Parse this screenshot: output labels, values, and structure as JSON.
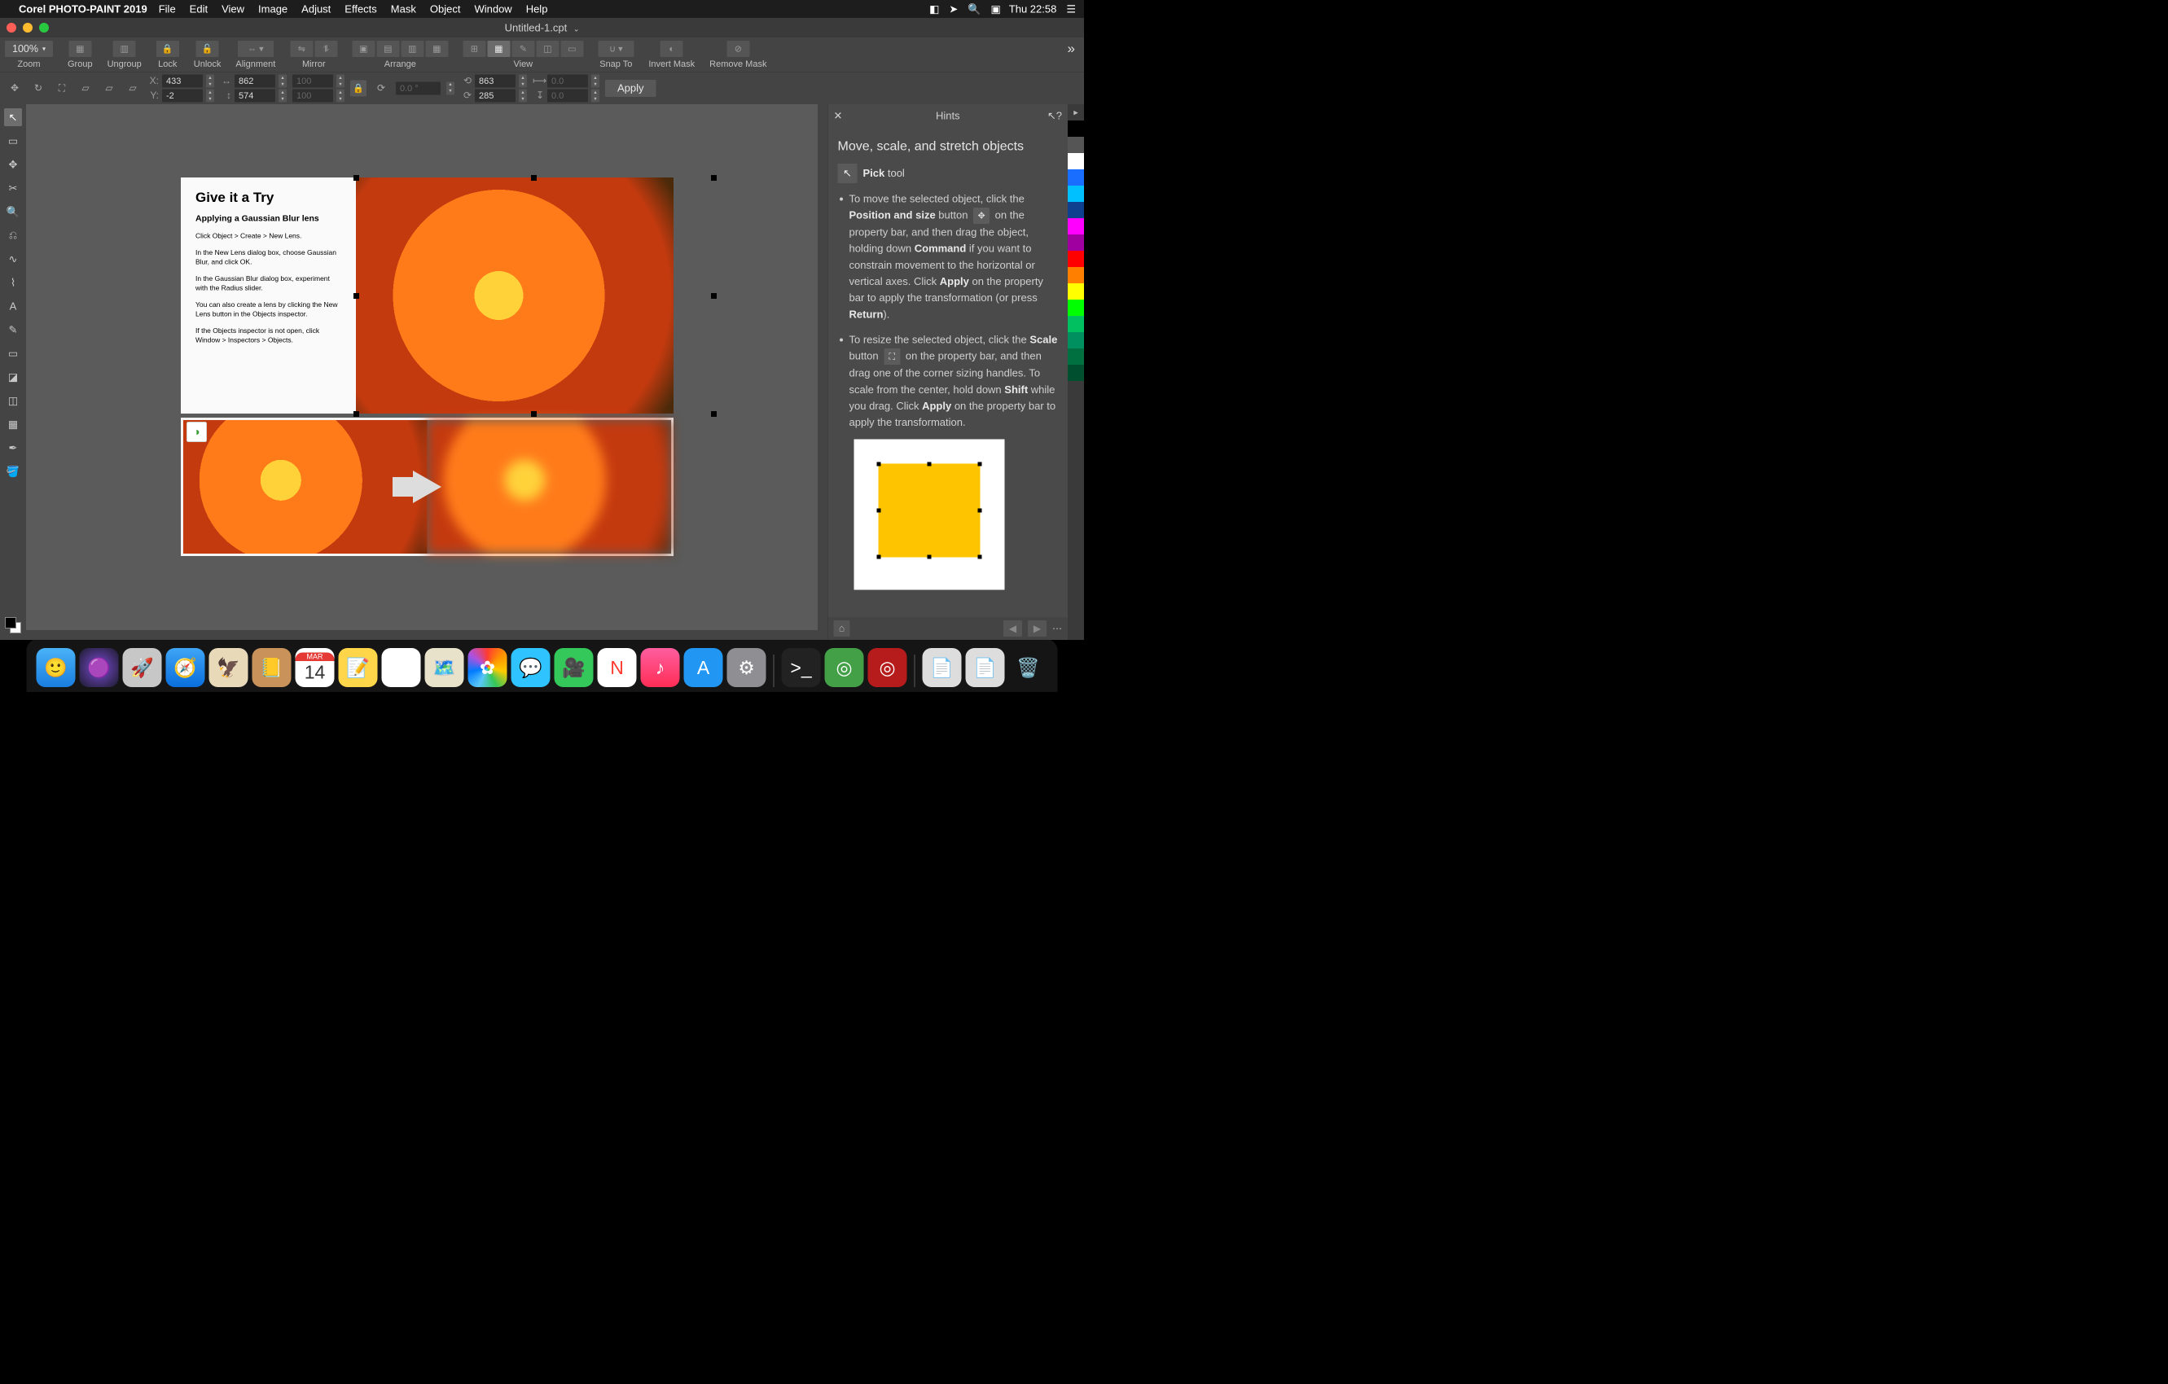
{
  "menubar": {
    "app_name": "Corel PHOTO-PAINT 2019",
    "items": [
      "File",
      "Edit",
      "View",
      "Image",
      "Adjust",
      "Effects",
      "Mask",
      "Object",
      "Window",
      "Help"
    ],
    "clock": "Thu 22:58"
  },
  "document": {
    "title": "Untitled-1.cpt"
  },
  "toolbar": {
    "zoom": {
      "value": "100%",
      "label": "Zoom"
    },
    "group": {
      "label": "Group"
    },
    "ungroup": {
      "label": "Ungroup"
    },
    "lock": {
      "label": "Lock"
    },
    "unlock": {
      "label": "Unlock"
    },
    "alignment": {
      "label": "Alignment"
    },
    "mirror": {
      "label": "Mirror"
    },
    "arrange": {
      "label": "Arrange"
    },
    "view": {
      "label": "View"
    },
    "snap_to": {
      "label": "Snap To"
    },
    "invert_mask": {
      "label": "Invert Mask"
    },
    "remove_mask": {
      "label": "Remove Mask"
    }
  },
  "propbar": {
    "x_label": "X:",
    "x": "433",
    "y_label": "Y:",
    "y": "-2",
    "w": "862",
    "h": "574",
    "sx": "100",
    "sy": "100",
    "rotation": "0.0 °",
    "skx": "863",
    "sky": "285",
    "dx": "0.0",
    "dy": "0.0",
    "apply": "Apply"
  },
  "canvas_text": {
    "heading": "Give it a Try",
    "sub": "Applying a Gaussian Blur lens",
    "p1": "Click Object > Create > New Lens.",
    "p2": "In the New Lens dialog box, choose Gaussian Blur, and click OK.",
    "p3": "In the Gaussian Blur dialog box, experiment with the Radius slider.",
    "p4": "You can also create a lens by clicking the New Lens button in the Objects inspector.",
    "p5": "If the Objects inspector is not open, click Window > Inspectors > Objects."
  },
  "hints": {
    "title": "Hints",
    "heading": "Move, scale, and stretch objects",
    "tool_name": "Pick",
    "tool_suffix": " tool",
    "b1_a": "To move the selected object, click the ",
    "b1_b": "Position and size",
    "b1_c": " button ",
    "b1_d": " on the property bar, and then drag the object, holding down ",
    "b1_e": "Command",
    "b1_f": " if you want to constrain movement to the horizontal or vertical axes. Click ",
    "b1_g": "Apply",
    "b1_h": " on the property bar to apply the transformation (or press ",
    "b1_i": "Return",
    "b1_j": ").",
    "b2_a": "To resize the selected object, click the ",
    "b2_b": "Scale",
    "b2_c": " button ",
    "b2_d": " on the property bar, and then drag one of the corner sizing handles. To scale from the center, hold down ",
    "b2_e": "Shift",
    "b2_f": " while you drag. Click ",
    "b2_g": "Apply",
    "b2_h": " on the property bar to apply the transformation."
  },
  "colors": [
    "#000000",
    "#ffffff",
    "#1a6eff",
    "#00a2e8",
    "#00c0ff",
    "#ff0000",
    "#ff00ff",
    "#ffff00",
    "#b5e61d",
    "#22b14c",
    "#009e4a",
    "#00a99d",
    "#007a5e",
    "#004020"
  ],
  "dock": {
    "apps": [
      "finder",
      "siri",
      "launchpad",
      "safari",
      "mail",
      "contacts",
      "calendar",
      "notes",
      "reminders",
      "maps",
      "photos",
      "messages",
      "facetime",
      "news",
      "music",
      "appstore",
      "settings"
    ],
    "calendar_month": "MAR",
    "calendar_day": "14",
    "tray": [
      "terminal",
      "corel-connect",
      "corel-capture",
      "doc1",
      "doc2",
      "trash"
    ]
  }
}
